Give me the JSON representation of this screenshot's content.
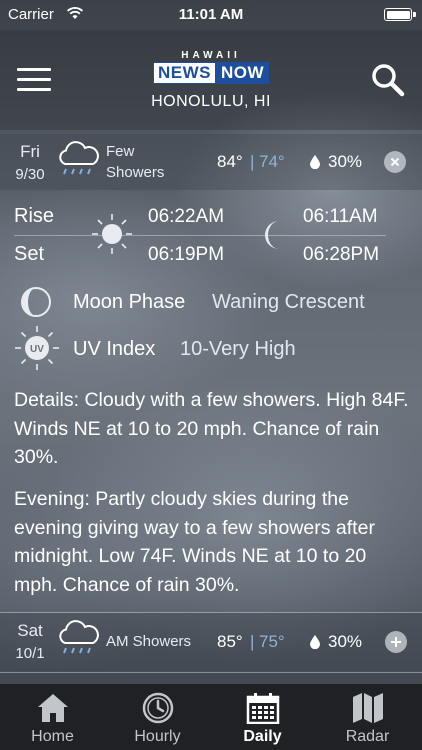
{
  "status_bar": {
    "carrier": "Carrier",
    "time": "11:01 AM"
  },
  "header": {
    "logo_top": "HAWAII",
    "logo_news": "NEWS",
    "logo_now": "NOW",
    "location": "HONOLULU, HI",
    "menu_icon": "hamburger-menu-icon",
    "search_icon": "search-icon"
  },
  "day_expanded": {
    "day": "Fri",
    "date": "9/30",
    "condition_line1": "Few",
    "condition_line2": "Showers",
    "high": "84°",
    "low": "74°",
    "separator": "|",
    "precip": "30%",
    "toggle_icon": "close-icon"
  },
  "sun_moon": {
    "rise_label": "Rise",
    "set_label": "Set",
    "sunrise": "06:22AM",
    "sunset": "06:19PM",
    "moonrise": "06:11AM",
    "moonset": "06:28PM"
  },
  "moon_phase": {
    "label": "Moon Phase",
    "value": "Waning Crescent"
  },
  "uv_index": {
    "label": "UV Index",
    "value": "10-Very High",
    "icon_text": "UV"
  },
  "details": {
    "day": "Details: Cloudy with a few showers. High 84F. Winds NE at 10 to 20 mph. Chance of rain 30%.",
    "evening": "Evening: Partly cloudy skies during the evening giving way to a few showers after midnight. Low 74F. Winds NE at 10 to 20 mph. Chance of rain 30%."
  },
  "day_next": {
    "day": "Sat",
    "date": "10/1",
    "condition": "AM Showers",
    "high": "85°",
    "low": "75°",
    "separator": "|",
    "precip": "30%",
    "toggle_icon": "plus-icon"
  },
  "tabs": [
    {
      "label": "Home",
      "icon": "home-icon",
      "active": false
    },
    {
      "label": "Hourly",
      "icon": "clock-icon",
      "active": false
    },
    {
      "label": "Daily",
      "icon": "calendar-icon",
      "active": true
    },
    {
      "label": "Radar",
      "icon": "map-icon",
      "active": false
    }
  ],
  "colors": {
    "low_temp": "#8fb3d9",
    "logo_blue": "#1e4f9e",
    "tab_bar": "#1f2124"
  }
}
